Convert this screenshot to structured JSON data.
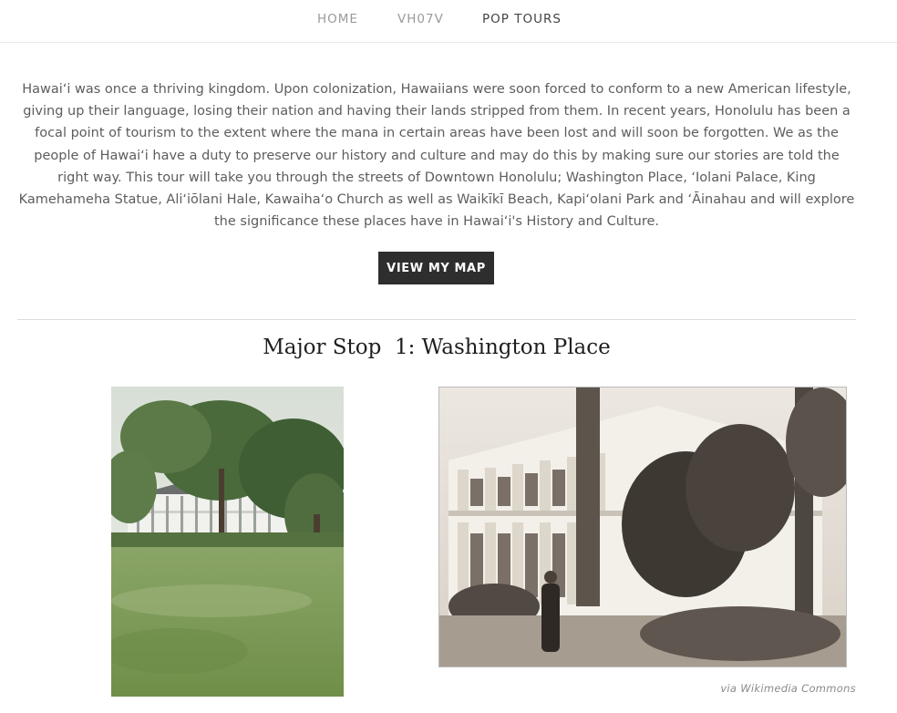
{
  "nav": {
    "items": [
      {
        "label": "HOME"
      },
      {
        "label": "VH07V"
      },
      {
        "label": "POP TOURS"
      }
    ]
  },
  "intro": {
    "text": "Hawaiʻi was once a thriving kingdom. Upon colonization, Hawaiians were soon forced to conform to a new American lifestyle, giving up their language, losing their nation and having their lands stripped from them. In recent years, Honolulu has been a focal point of tourism to the extent where the mana in certain areas have been lost and will soon be forgotten. We as the people of Hawaiʻi have a duty to preserve our history and culture and may do this by making sure our stories are told the right way. This tour will take you through the streets of Downtown Honolulu; Washington Place, ʻIolani Palace, King  Kamehameha Statue, Aliʻiōlani Hale, Kawaihaʻo Church as well as Waikīkī Beach, Kapiʻolani Park and ʻĀinahau and will explore the significance these places have in Hawaiʻi's History and Culture."
  },
  "button": {
    "label": "VIEW MY MAP"
  },
  "section": {
    "heading": "Major Stop  1: Washington Place"
  },
  "images": {
    "caption": "via Wikimedia Commons"
  }
}
